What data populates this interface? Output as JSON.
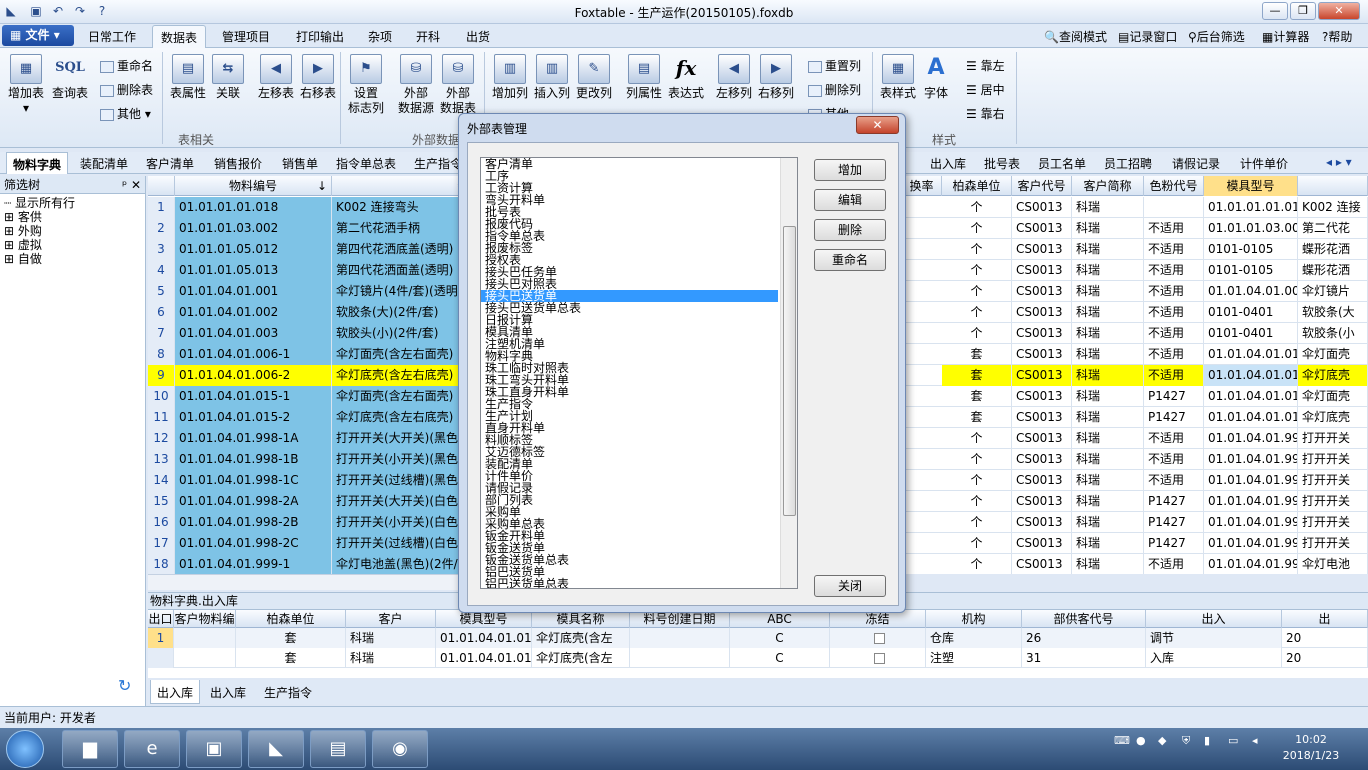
{
  "window": {
    "title": "Foxtable - 生产运作(20150105).foxdb"
  },
  "menu": {
    "file": "文件",
    "tabs": [
      "日常工作",
      "数据表",
      "管理项目",
      "打印输出",
      "杂项",
      "开科",
      "出货"
    ],
    "tools": [
      "查阅模式",
      "记录窗口",
      "后台筛选",
      "计算器",
      "帮助"
    ]
  },
  "ribbon": {
    "g1": {
      "add_table": "增加表",
      "query_table": "查询表",
      "rename": "重命名",
      "delete_table": "删除表",
      "other": "其他"
    },
    "g2": {
      "table_prop": "表属性",
      "relation": "关联",
      "move_left": "左移表",
      "move_right": "右移表",
      "label": "表相关"
    },
    "g3": {
      "set_flag_col": "设置\n标志列",
      "ext_source": "外部\n数据源",
      "ext_table": "外部\n数据表",
      "label": "外部数据"
    },
    "g4": {
      "add_col": "增加列",
      "insert_col": "插入列",
      "change_col": "更改列",
      "col_prop": "列属性",
      "expr": "表达式",
      "col_left": "左移列",
      "col_right": "右移列",
      "reset_col": "重置列",
      "del_col": "删除列",
      "other2": "其他"
    },
    "g5": {
      "table_style": "表样式",
      "font": "字体",
      "align_left": "靠左",
      "align_center": "居中",
      "align_right": "靠右",
      "label": "样式"
    }
  },
  "table_tabs": [
    "物料字典",
    "装配清单",
    "客户清单",
    "销售报价",
    "销售单",
    "指令单总表",
    "生产指令",
    "出入库",
    "批号表",
    "员工名单",
    "员工招聘",
    "请假记录",
    "计件单价"
  ],
  "left_panel": {
    "title": "筛选树",
    "items": [
      "显示所有行",
      "客供",
      "外购",
      "虚拟",
      "自做"
    ]
  },
  "grid": {
    "headers": {
      "code": "物料编号",
      "name": "物料名称",
      "rate": "换率",
      "unit": "柏森单位",
      "cust": "客户代号",
      "abbr": "客户简称",
      "color": "色粉代号",
      "mold": "模具型号",
      "sort_mark": "↓"
    },
    "rows": [
      {
        "n": "1",
        "code": "01.01.01.01.018",
        "name": "K002 连接弯头",
        "unit": "个",
        "cust": "CS0013",
        "abbr": "科瑞",
        "color": "",
        "mold": "01.01.01.01.01",
        "extra": "K002 连接"
      },
      {
        "n": "2",
        "code": "01.01.01.03.002",
        "name": "第二代花洒手柄",
        "unit": "个",
        "cust": "CS0013",
        "abbr": "科瑞",
        "color": "不适用",
        "mold": "01.01.01.03.00",
        "extra": "第二代花"
      },
      {
        "n": "3",
        "code": "01.01.01.05.012",
        "name": "第四代花洒底盖(透明)",
        "unit": "个",
        "cust": "CS0013",
        "abbr": "科瑞",
        "color": "不适用",
        "mold": "0101-0105",
        "extra": "蝶形花洒"
      },
      {
        "n": "4",
        "code": "01.01.01.05.013",
        "name": "第四代花洒面盖(透明)",
        "unit": "个",
        "cust": "CS0013",
        "abbr": "科瑞",
        "color": "不适用",
        "mold": "0101-0105",
        "extra": "蝶形花洒"
      },
      {
        "n": "5",
        "code": "01.01.04.01.001",
        "name": "伞灯镜片(4件/套)(透明",
        "unit": "个",
        "cust": "CS0013",
        "abbr": "科瑞",
        "color": "不适用",
        "mold": "01.01.04.01.00",
        "extra": "伞灯镜片"
      },
      {
        "n": "6",
        "code": "01.01.04.01.002",
        "name": "软胶条(大)(2件/套)",
        "unit": "个",
        "cust": "CS0013",
        "abbr": "科瑞",
        "color": "不适用",
        "mold": "0101-0401",
        "extra": "软胶条(大"
      },
      {
        "n": "7",
        "code": "01.01.04.01.003",
        "name": "软胶头(小)(2件/套)",
        "unit": "个",
        "cust": "CS0013",
        "abbr": "科瑞",
        "color": "不适用",
        "mold": "0101-0401",
        "extra": "软胶条(小"
      },
      {
        "n": "8",
        "code": "01.01.04.01.006-1",
        "name": "伞灯面壳(含左右面壳)",
        "unit": "套",
        "cust": "CS0013",
        "abbr": "科瑞",
        "color": "不适用",
        "mold": "01.01.04.01.01",
        "extra": "伞灯面壳"
      },
      {
        "n": "9",
        "code": "01.01.04.01.006-2",
        "name": "伞灯底壳(含左右底壳)",
        "unit": "套",
        "cust": "CS0013",
        "abbr": "科瑞",
        "color": "不适用",
        "mold": "01.01.04.01.01",
        "extra": "伞灯底壳",
        "hl": true
      },
      {
        "n": "10",
        "code": "01.01.04.01.015-1",
        "name": "伞灯面壳(含左右面壳)",
        "unit": "套",
        "cust": "CS0013",
        "abbr": "科瑞",
        "color": "P1427",
        "mold": "01.01.04.01.01",
        "extra": "伞灯面壳"
      },
      {
        "n": "11",
        "code": "01.01.04.01.015-2",
        "name": "伞灯底壳(含左右底壳)",
        "unit": "套",
        "cust": "CS0013",
        "abbr": "科瑞",
        "color": "P1427",
        "mold": "01.01.04.01.01",
        "extra": "伞灯底壳"
      },
      {
        "n": "12",
        "code": "01.01.04.01.998-1A",
        "name": "打开开关(大开关)(黑色",
        "unit": "个",
        "cust": "CS0013",
        "abbr": "科瑞",
        "color": "不适用",
        "mold": "01.01.04.01.99",
        "extra": "打开开关"
      },
      {
        "n": "13",
        "code": "01.01.04.01.998-1B",
        "name": "打开开关(小开关)(黑色",
        "unit": "个",
        "cust": "CS0013",
        "abbr": "科瑞",
        "color": "不适用",
        "mold": "01.01.04.01.99",
        "extra": "打开开关"
      },
      {
        "n": "14",
        "code": "01.01.04.01.998-1C",
        "name": "打开开关(过线槽)(黑色",
        "unit": "个",
        "cust": "CS0013",
        "abbr": "科瑞",
        "color": "不适用",
        "mold": "01.01.04.01.99",
        "extra": "打开开关"
      },
      {
        "n": "15",
        "code": "01.01.04.01.998-2A",
        "name": "打开开关(大开关)(白色",
        "unit": "个",
        "cust": "CS0013",
        "abbr": "科瑞",
        "color": "P1427",
        "mold": "01.01.04.01.99",
        "extra": "打开开关"
      },
      {
        "n": "16",
        "code": "01.01.04.01.998-2B",
        "name": "打开开关(小开关)(白色",
        "unit": "个",
        "cust": "CS0013",
        "abbr": "科瑞",
        "color": "P1427",
        "mold": "01.01.04.01.99",
        "extra": "打开开关"
      },
      {
        "n": "17",
        "code": "01.01.04.01.998-2C",
        "name": "打开开关(过线槽)(白色",
        "unit": "个",
        "cust": "CS0013",
        "abbr": "科瑞",
        "color": "P1427",
        "mold": "01.01.04.01.99",
        "extra": "打开开关"
      },
      {
        "n": "18",
        "code": "01.01.04.01.999-1",
        "name": "伞灯电池盖(黑色)(2件/",
        "unit": "个",
        "cust": "CS0013",
        "abbr": "科瑞",
        "color": "不适用",
        "mold": "01.01.04.01.99",
        "extra": "伞灯电池"
      }
    ]
  },
  "bottom": {
    "title": "物料字典.出入库",
    "headers": [
      "出口",
      "客户物料编号",
      "柏森单位",
      "客户",
      "模具型号",
      "模具名称",
      "料号创建日期",
      "ABC",
      "冻结",
      "机构",
      "部供客代号",
      "出入"
    ],
    "rows": [
      [
        "1",
        "",
        "套",
        "科瑞",
        "01.01.04.01.01",
        "伞灯底壳(含左",
        "",
        "C",
        "",
        "仓库",
        "26",
        "调节"
      ],
      [
        "",
        "",
        "套",
        "科瑞",
        "01.01.04.01.01",
        "伞灯底壳(含左",
        "",
        "C",
        "",
        "注塑",
        "31",
        "入库"
      ]
    ],
    "extra_col": [
      "出",
      "20",
      "20"
    ],
    "tabs": [
      "出入库",
      "出入库",
      "生产指令"
    ]
  },
  "status": {
    "user": "当前用户: 开发者"
  },
  "clock": {
    "time": "10:02",
    "date": "2018/1/23"
  },
  "dialog": {
    "title": "外部表管理",
    "buttons": {
      "add": "增加",
      "edit": "编辑",
      "delete": "删除",
      "rename": "重命名",
      "close": "关闭"
    },
    "items": [
      "客户清单",
      "工序",
      "工资计算",
      "弯头开料单",
      "批号表",
      "报废代码",
      "指令单总表",
      "报废标签",
      "授权表",
      "接头巴任务单",
      "接头巴对照表",
      "接头巴送货单",
      "接头巴送货单总表",
      "日报计算",
      "模具清单",
      "注塑机清单",
      "物料字典",
      "珠工临时对照表",
      "珠工弯头开料单",
      "珠工直身开料单",
      "生产指令",
      "生产计划",
      "直身开料单",
      "料顺标签",
      "艾迈德标签",
      "装配清单",
      "计件单价",
      "请假记录",
      "部门列表",
      "采购单",
      "采购单总表",
      "钣金开料单",
      "钣金送货单",
      "钣金送货单总表",
      "铝巴送货单",
      "铝巴送货单总表"
    ],
    "selected_index": 11
  }
}
